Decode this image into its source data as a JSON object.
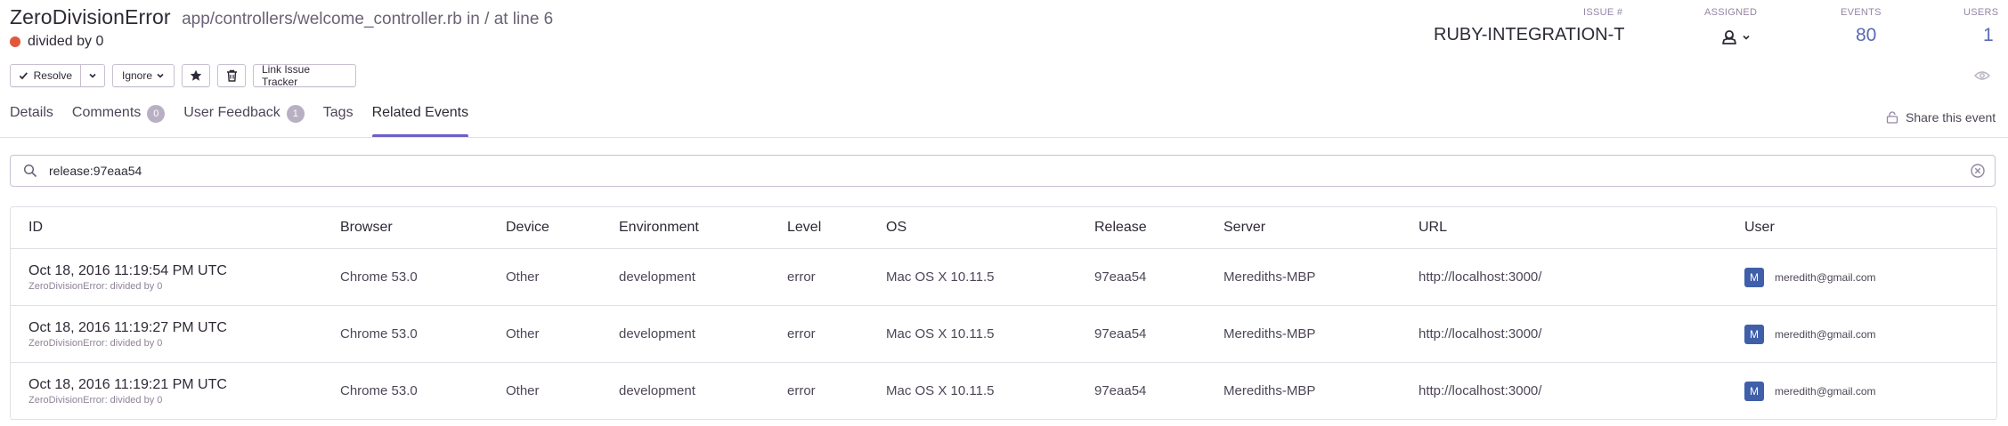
{
  "header": {
    "title": "ZeroDivisionError",
    "culprit": "app/controllers/welcome_controller.rb in / at line 6",
    "message": "divided by 0",
    "level_color": "#e2573b"
  },
  "stats": {
    "issue_label": "ISSUE #",
    "issue_value": "RUBY-INTEGRATION-T",
    "assigned_label": "ASSIGNED",
    "assigned_icon": "user-icon",
    "events_label": "EVENTS",
    "events_value": "80",
    "users_label": "USERS",
    "users_value": "1"
  },
  "actions": {
    "resolve": "Resolve",
    "ignore": "Ignore",
    "bookmark_icon": "star-icon",
    "delete_icon": "trash-icon",
    "link_tracker": "Link Issue Tracker"
  },
  "tabs": [
    {
      "label": "Details"
    },
    {
      "label": "Comments",
      "count": "0"
    },
    {
      "label": "User Feedback",
      "count": "1"
    },
    {
      "label": "Tags"
    },
    {
      "label": "Related Events",
      "active": true
    }
  ],
  "share_label": "Share this event",
  "search": {
    "value": "release:97eaa54"
  },
  "table": {
    "columns": [
      "ID",
      "Browser",
      "Device",
      "Environment",
      "Level",
      "OS",
      "Release",
      "Server",
      "URL",
      "User"
    ],
    "rows": [
      {
        "date": "Oct 18, 2016 11:19:54 PM UTC",
        "sub": "ZeroDivisionError: divided by 0",
        "browser": "Chrome 53.0",
        "device": "Other",
        "environment": "development",
        "level": "error",
        "os": "Mac OS X 10.11.5",
        "release": "97eaa54",
        "server": "Merediths-MBP",
        "url": "http://localhost:3000/",
        "avatar": "M",
        "user": "meredith@gmail.com"
      },
      {
        "date": "Oct 18, 2016 11:19:27 PM UTC",
        "sub": "ZeroDivisionError: divided by 0",
        "browser": "Chrome 53.0",
        "device": "Other",
        "environment": "development",
        "level": "error",
        "os": "Mac OS X 10.11.5",
        "release": "97eaa54",
        "server": "Merediths-MBP",
        "url": "http://localhost:3000/",
        "avatar": "M",
        "user": "meredith@gmail.com"
      },
      {
        "date": "Oct 18, 2016 11:19:21 PM UTC",
        "sub": "ZeroDivisionError: divided by 0",
        "browser": "Chrome 53.0",
        "device": "Other",
        "environment": "development",
        "level": "error",
        "os": "Mac OS X 10.11.5",
        "release": "97eaa54",
        "server": "Merediths-MBP",
        "url": "http://localhost:3000/",
        "avatar": "M",
        "user": "meredith@gmail.com"
      }
    ]
  }
}
